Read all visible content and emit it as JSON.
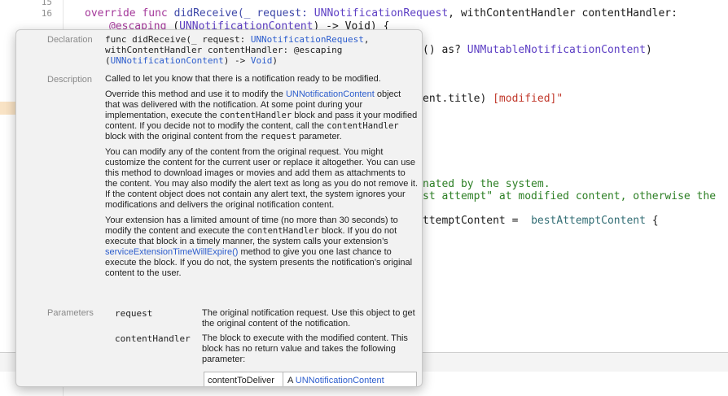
{
  "editor": {
    "line_numbers": [
      "15",
      "16"
    ],
    "line16": {
      "kw1": "override",
      "kw2": "func",
      "fn": "didReceive(_ request:",
      "ty1": "UNNotificationRequest",
      "rest1": ", withContentHandler contentHandler:"
    },
    "line17": {
      "kw": "@escaping",
      "open": "(",
      "ty": "UNNotificationContent",
      "close": ") -> Void) {"
    },
    "frag_a": {
      "pre": "() as? ",
      "ty": "UNMutableNotificationContent",
      "post": ")"
    },
    "frag_b": {
      "pre": "ent.title) ",
      "str": "[modified]\""
    },
    "frag_c": "nated by the system.",
    "frag_d": "st attempt\" at modified content, otherwise the",
    "frag_e": {
      "pre": "ttemptContent =  ",
      "id": "bestAttemptContent",
      "post": " {"
    }
  },
  "quick_help": {
    "declaration_label": "Declaration",
    "declaration": {
      "line1_pre": "func didReceive(_ request: ",
      "line1_type": "UNNotificationRequest",
      "line1_post": ",",
      "line2": "withContentHandler contentHandler: @escaping",
      "line3_open": "(",
      "line3_type": "UNNotificationContent",
      "line3_post": ") -> ",
      "line3_void": "Void",
      "line3_close": ")"
    },
    "description_label": "Description",
    "description": {
      "p1": "Called to let you know that there is a notification ready to be modified.",
      "p2_a": "Override this method and use it to modify the ",
      "p2_link": "UNNotificationContent",
      "p2_b": " object that was delivered with the notification. At some point during your implementation, execute the ",
      "p2_code1": "contentHandler",
      "p2_c": " block and pass it your modified content. If you decide not to modify the content, call the ",
      "p2_code2": "contentHandler",
      "p2_d": " block with the original content from the ",
      "p2_code3": "request",
      "p2_e": " parameter.",
      "p3": "You can modify any of the content from the original request. You might customize the content for the current user or replace it altogether. You can use this method to download images or movies and add them as attachments to the content. You may also modify the alert text as long as you do not remove it. If the content object does not contain any alert text, the system ignores your modifications and delivers the original notification content.",
      "p4_a": "Your extension has a limited amount of time (no more than 30 seconds) to modify the content and execute the ",
      "p4_code": "contentHandler",
      "p4_b": " block. If you do not execute that block in a timely manner, the system calls your extension’s ",
      "p4_link": "serviceExtensionTimeWillExpire()",
      "p4_c": " method to give you one last chance to execute the block. If you do not, the system presents the notification’s original content to the user."
    },
    "parameters_label": "Parameters",
    "parameters": [
      {
        "name": "request",
        "desc": "The original notification request. Use this object to get the original content of the notification."
      },
      {
        "name": "contentHandler",
        "desc": "The block to execute with the modified content. This block has no return value and takes the following parameter:"
      }
    ],
    "subparam": {
      "name": "contentToDeliver",
      "desc_pre": "A ",
      "desc_link": "UNNotificationContent"
    }
  }
}
